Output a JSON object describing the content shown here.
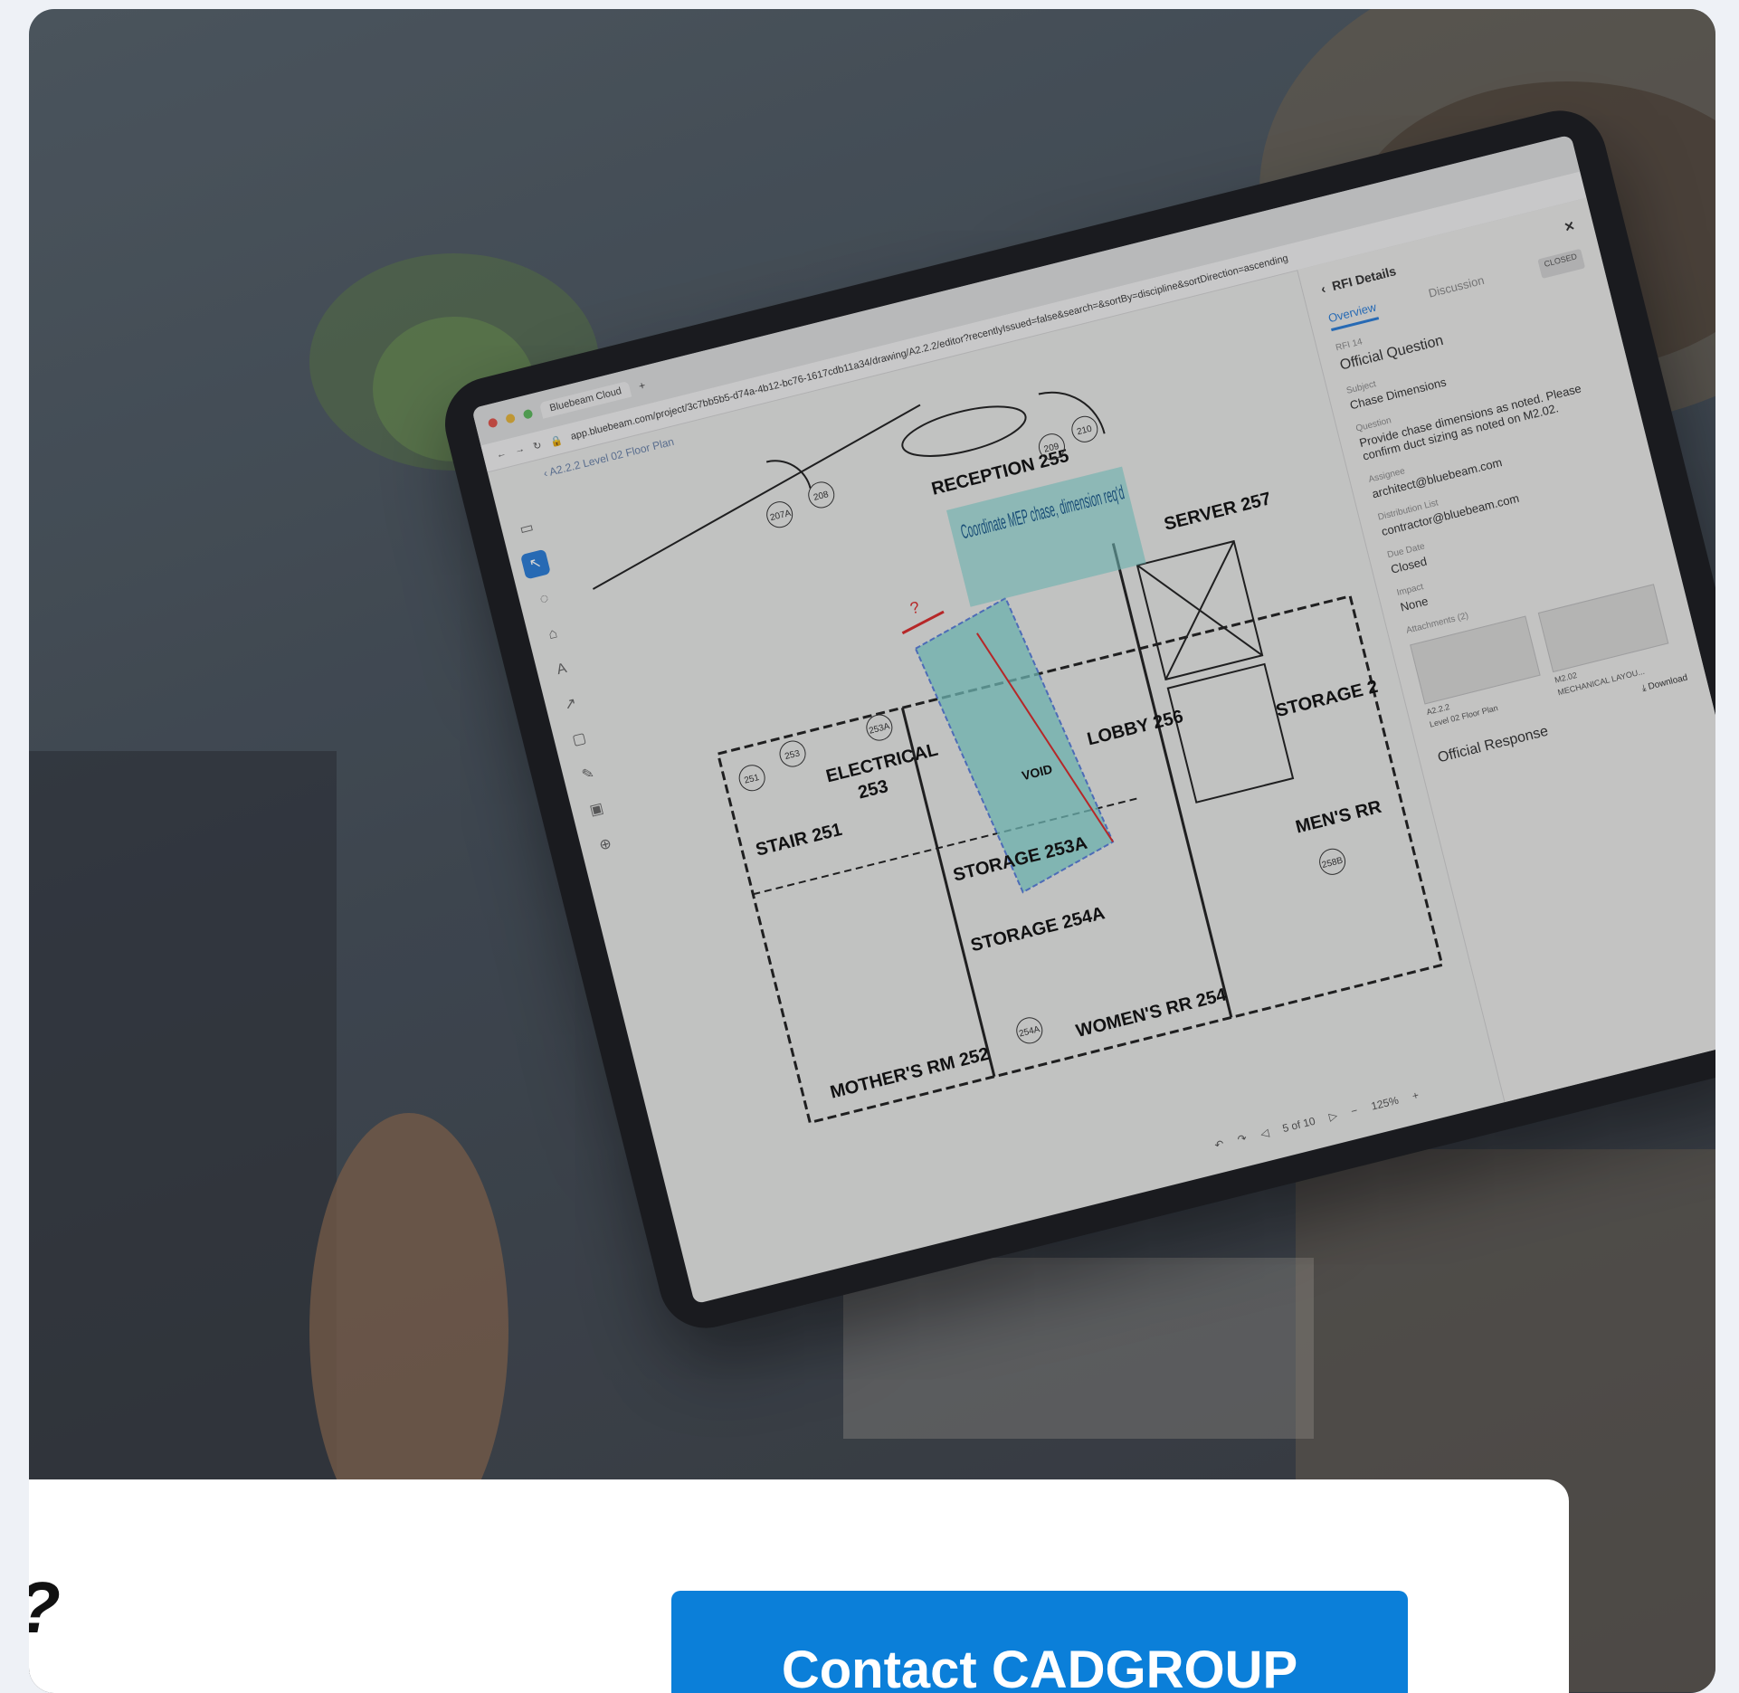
{
  "browser": {
    "tab_title": "Bluebeam Cloud",
    "url": "app.bluebeam.com/project/3c7bb5b5-d74a-4b12-bc76-1617cdb11a34/drawing/A2.2.2/editor?recentlyIssued=false&search=&sortBy=discipline&sortDirection=ascending"
  },
  "viewer": {
    "breadcrumb_code": "A2.2.2",
    "breadcrumb_name": "Level 02 Floor Plan",
    "page_indicator": "5 of 10",
    "zoom": "125%"
  },
  "floor_plan": {
    "rooms": [
      "RECEPTION 255",
      "SERVER 257",
      "ELECTRICAL",
      "253",
      "STAIR 251",
      "STORAGE 253A",
      "STORAGE 254A",
      "LOBBY 256",
      "STORAGE 2",
      "MEN'S RR",
      "MOTHER'S RM 252",
      "WOMEN'S RR 254",
      "VOID"
    ],
    "door_tags": [
      "207A",
      "208",
      "209",
      "210",
      "251",
      "253",
      "253A",
      "254A",
      "258B"
    ],
    "markup_note": "Coordinate MEP chase, dimension req'd",
    "dimension_label": "?"
  },
  "rfi_panel": {
    "header": "RFI Details",
    "tab_overview": "Overview",
    "tab_discussion": "Discussion",
    "status": "CLOSED",
    "rfi_number": "RFI 14",
    "section_title": "Official Question",
    "subject_label": "Subject",
    "subject": "Chase Dimensions",
    "question_label": "Question",
    "question": "Provide chase dimensions as noted. Please confirm duct sizing as noted on M2.02.",
    "assignee_label": "Assignee",
    "assignee": "architect@bluebeam.com",
    "distribution_label": "Distribution List",
    "distribution": "contractor@bluebeam.com",
    "due_label": "Due Date",
    "due": "Closed",
    "impact_label": "Impact",
    "impact": "None",
    "attachments_label": "Attachments (2)",
    "attachment_1_code": "A2.2.2",
    "attachment_1_name": "Level 02 Floor Plan",
    "attachment_2_code": "M2.02",
    "attachment_2_name": "MECHANICAL LAYOU...",
    "download": "Download",
    "official_response": "Official Response"
  },
  "cta": {
    "question_fragment": "?",
    "button_label": "Contact CADGROUP"
  },
  "colors": {
    "cta_blue": "#0b7fd9",
    "markup_cyan": "#7fd3cf",
    "markup_red": "#d92b2b",
    "selection_blue": "#2b7dd6"
  }
}
